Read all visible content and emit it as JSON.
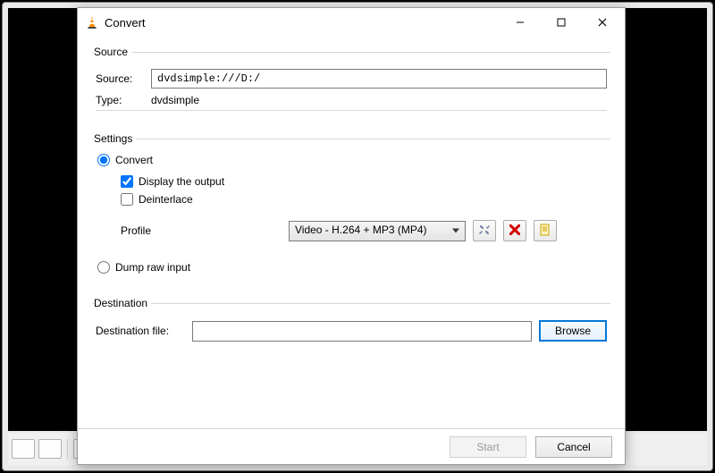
{
  "window": {
    "title": "Convert",
    "min": "—",
    "max": "☐",
    "close": "✕"
  },
  "source": {
    "legend": "Source",
    "source_label": "Source:",
    "source_value": "dvdsimple:///D:/",
    "type_label": "Type:",
    "type_value": "dvdsimple"
  },
  "settings": {
    "legend": "Settings",
    "convert_label": "Convert",
    "display_output_label": "Display the output",
    "deinterlace_label": "Deinterlace",
    "profile_label": "Profile",
    "profile_value": "Video - H.264 + MP3 (MP4)",
    "dump_label": "Dump raw input"
  },
  "destination": {
    "legend": "Destination",
    "label": "Destination file:",
    "value": "",
    "browse": "Browse"
  },
  "footer": {
    "start": "Start",
    "cancel": "Cancel"
  },
  "icons": {
    "tools": "tools-icon",
    "delete": "delete-icon",
    "new": "new-profile-icon"
  }
}
